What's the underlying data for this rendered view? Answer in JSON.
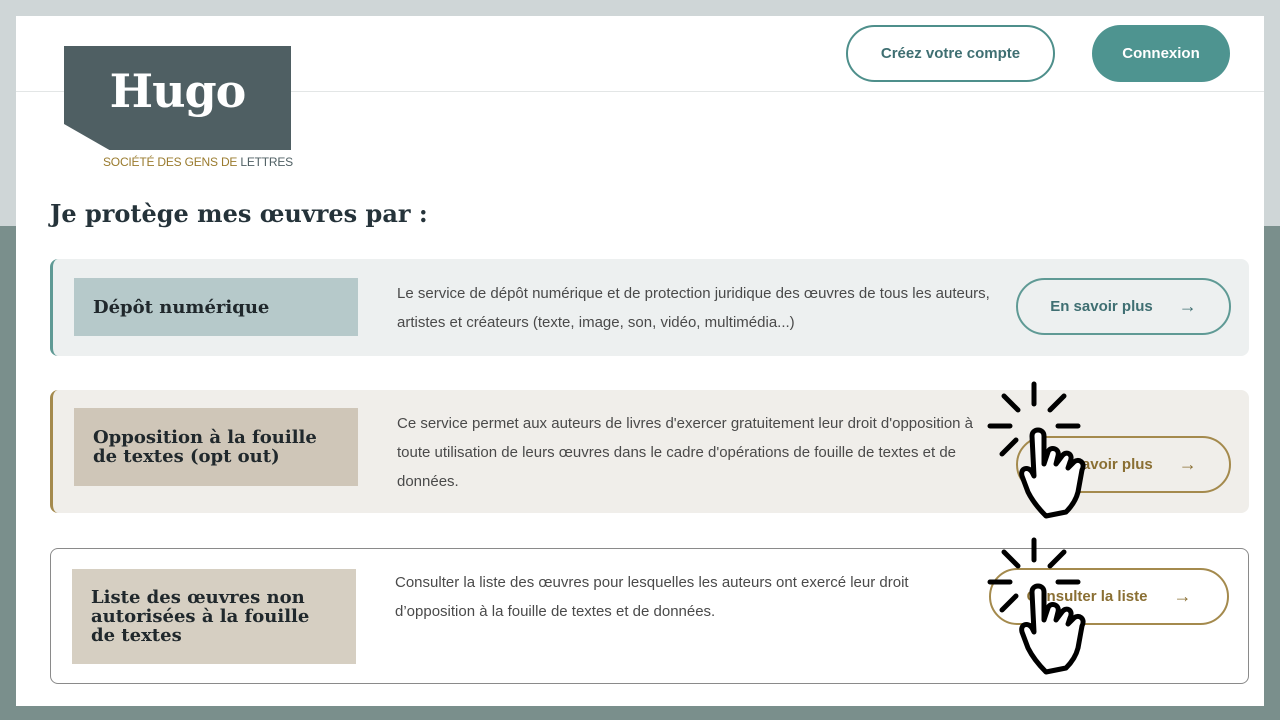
{
  "logo": {
    "name": "Hugo",
    "tagline_part1": "SOCIÉTÉ DES GENS DE ",
    "tagline_part2": "LETTRES"
  },
  "header": {
    "create_account_label": "Créez votre compte",
    "login_label": "Connexion"
  },
  "section_title": "Je protège mes œuvres par :",
  "cards": [
    {
      "title": "Dépôt numérique",
      "description": "Le service de dépôt numérique et de protection juridique des œuvres de tous les auteurs, artistes et créateurs (texte, image, son, vidéo, multimédia...)",
      "button_label": "En savoir plus",
      "arrow": "→"
    },
    {
      "title": "Opposition à la fouille de textes (opt out)",
      "description": "Ce service permet aux auteurs de livres d'exercer gratuitement leur droit d'opposition à toute utilisation de leurs œuvres dans le cadre d'opérations de fouille de textes et de données.",
      "button_label": "En savoir plus",
      "arrow": "→"
    },
    {
      "title": "Liste des œuvres non autorisées à la fouille de textes",
      "description": "Consulter la liste des œuvres pour lesquelles les auteurs ont exercé leur droit d’opposition à la fouille de textes et de données.",
      "button_label": "Consulter la liste",
      "arrow": "→"
    }
  ],
  "colors": {
    "teal": "#4e9490",
    "gold": "#a48a4d",
    "slate": "#4f5f63"
  }
}
